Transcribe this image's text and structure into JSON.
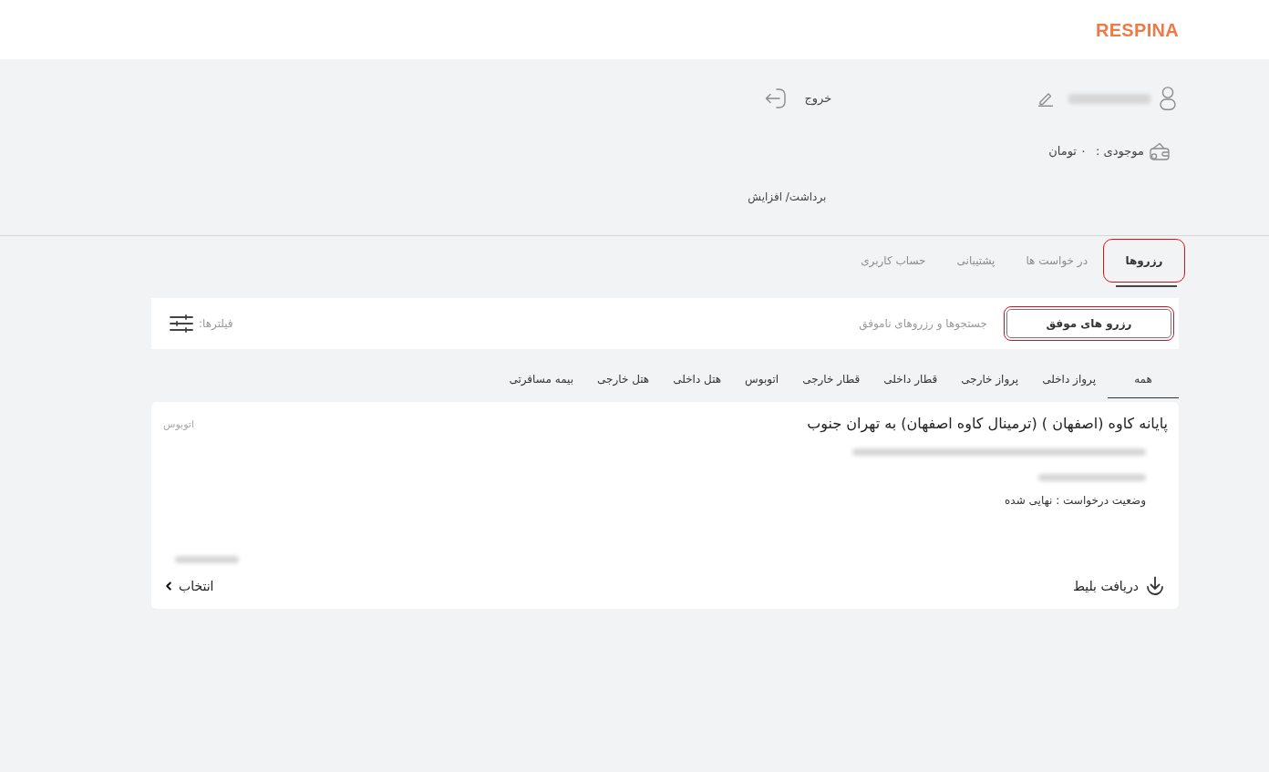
{
  "header": {
    "logo": "RESPINA"
  },
  "account": {
    "logout": "خروج",
    "balance_label": "موجودی :",
    "balance_value": "۰ تومان",
    "withdraw_link": "برداشت/ افزایش"
  },
  "tabs": [
    {
      "label": "رزروها",
      "selected": true,
      "highlighted": true
    },
    {
      "label": "در خواست ها",
      "selected": false,
      "highlighted": false
    },
    {
      "label": "پشتیبانی",
      "selected": false,
      "highlighted": false
    },
    {
      "label": "حساب کاربری",
      "selected": false,
      "highlighted": false
    }
  ],
  "reservation_filter": {
    "toggles": [
      {
        "label": "رزرو های موفق",
        "selected": true,
        "highlighted": true
      },
      {
        "label": "جستجوها و رزروهای ناموفق",
        "selected": false,
        "highlighted": false
      }
    ],
    "filters_label": "فیلترها:"
  },
  "categories": [
    {
      "label": "همه",
      "selected": true
    },
    {
      "label": "پرواز داخلی",
      "selected": false
    },
    {
      "label": "پرواز خارجی",
      "selected": false
    },
    {
      "label": "قطار داخلی",
      "selected": false
    },
    {
      "label": "قطار خارجی",
      "selected": false
    },
    {
      "label": "اتوبوس",
      "selected": false
    },
    {
      "label": "هتل داخلی",
      "selected": false
    },
    {
      "label": "هتل خارجی",
      "selected": false
    },
    {
      "label": "بیمه مسافرتی",
      "selected": false
    }
  ],
  "reservations": [
    {
      "title": "پایانه کاوه (اصفهان ) (ترمینال کاوه اصفهان) به تهران جنوب",
      "type": "اتوبوس",
      "status": "وضعیت درخواست : نهایی شده",
      "download": "دریافت بلیط",
      "select": "انتخاب"
    }
  ]
}
